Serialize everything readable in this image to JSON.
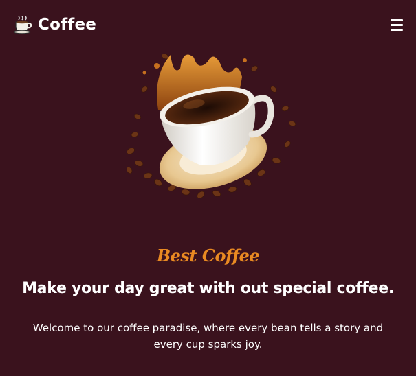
{
  "nav": {
    "brand_label": "Coffee",
    "brand_icon": "coffee-cup-icon",
    "menu_icon": "hamburger-menu-icon"
  },
  "hero": {
    "image": "coffee-cup-splash-with-beans",
    "tagline": "Best Coffee",
    "headline": "Make your day great with out special coffee.",
    "intro": "Welcome to our coffee paradise, where every bean tells a story and every cup sparks joy."
  },
  "colors": {
    "background": "#3a121d",
    "accent": "#e98a22",
    "text": "#ffffff"
  }
}
